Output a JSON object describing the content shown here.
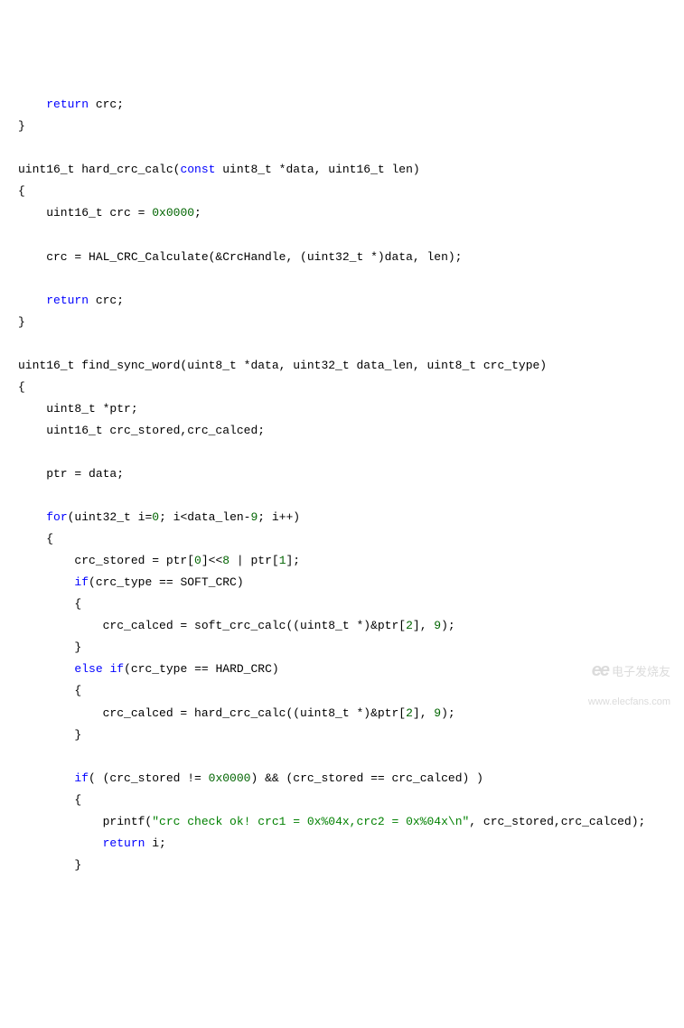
{
  "code": {
    "lines": [
      {
        "indent": 1,
        "tokens": [
          {
            "t": "return",
            "c": "kw"
          },
          {
            "t": " crc;",
            "c": ""
          }
        ]
      },
      {
        "indent": 0,
        "tokens": [
          {
            "t": "}",
            "c": ""
          }
        ]
      },
      {
        "indent": 0,
        "tokens": []
      },
      {
        "indent": 0,
        "tokens": [
          {
            "t": "uint16_t hard_crc_calc(",
            "c": ""
          },
          {
            "t": "const",
            "c": "kw"
          },
          {
            "t": " uint8_t *data, uint16_t len)",
            "c": ""
          }
        ]
      },
      {
        "indent": 0,
        "tokens": [
          {
            "t": "{",
            "c": ""
          }
        ]
      },
      {
        "indent": 1,
        "tokens": [
          {
            "t": "uint16_t crc = ",
            "c": ""
          },
          {
            "t": "0x0000",
            "c": "num"
          },
          {
            "t": ";",
            "c": ""
          }
        ]
      },
      {
        "indent": 0,
        "tokens": []
      },
      {
        "indent": 1,
        "tokens": [
          {
            "t": "crc = HAL_CRC_Calculate(&CrcHandle, (uint32_t *)data, len);",
            "c": ""
          }
        ]
      },
      {
        "indent": 0,
        "tokens": []
      },
      {
        "indent": 1,
        "tokens": [
          {
            "t": "return",
            "c": "kw"
          },
          {
            "t": " crc;",
            "c": ""
          }
        ]
      },
      {
        "indent": 0,
        "tokens": [
          {
            "t": "}",
            "c": ""
          }
        ]
      },
      {
        "indent": 0,
        "tokens": []
      },
      {
        "indent": 0,
        "tokens": [
          {
            "t": "uint16_t find_sync_word(uint8_t *data, uint32_t data_len, uint8_t crc_type)",
            "c": ""
          }
        ]
      },
      {
        "indent": 0,
        "tokens": [
          {
            "t": "{",
            "c": ""
          }
        ]
      },
      {
        "indent": 1,
        "tokens": [
          {
            "t": "uint8_t *ptr;",
            "c": ""
          }
        ]
      },
      {
        "indent": 1,
        "tokens": [
          {
            "t": "uint16_t crc_stored,crc_calced;",
            "c": ""
          }
        ]
      },
      {
        "indent": 0,
        "tokens": []
      },
      {
        "indent": 1,
        "tokens": [
          {
            "t": "ptr = data;",
            "c": ""
          }
        ]
      },
      {
        "indent": 0,
        "tokens": []
      },
      {
        "indent": 1,
        "tokens": [
          {
            "t": "for",
            "c": "kw"
          },
          {
            "t": "(uint32_t i=",
            "c": ""
          },
          {
            "t": "0",
            "c": "num"
          },
          {
            "t": "; i<data_len-",
            "c": ""
          },
          {
            "t": "9",
            "c": "num"
          },
          {
            "t": "; i++)",
            "c": ""
          }
        ]
      },
      {
        "indent": 1,
        "tokens": [
          {
            "t": "{",
            "c": ""
          }
        ]
      },
      {
        "indent": 2,
        "tokens": [
          {
            "t": "crc_stored = ptr[",
            "c": ""
          },
          {
            "t": "0",
            "c": "num"
          },
          {
            "t": "]<<",
            "c": ""
          },
          {
            "t": "8",
            "c": "num"
          },
          {
            "t": " | ptr[",
            "c": ""
          },
          {
            "t": "1",
            "c": "num"
          },
          {
            "t": "];",
            "c": ""
          }
        ]
      },
      {
        "indent": 2,
        "tokens": [
          {
            "t": "if",
            "c": "kw"
          },
          {
            "t": "(crc_type == SOFT_CRC)",
            "c": ""
          }
        ]
      },
      {
        "indent": 2,
        "tokens": [
          {
            "t": "{",
            "c": ""
          }
        ]
      },
      {
        "indent": 3,
        "tokens": [
          {
            "t": "crc_calced = soft_crc_calc((uint8_t *)&ptr[",
            "c": ""
          },
          {
            "t": "2",
            "c": "num"
          },
          {
            "t": "], ",
            "c": ""
          },
          {
            "t": "9",
            "c": "num"
          },
          {
            "t": ");",
            "c": ""
          }
        ]
      },
      {
        "indent": 2,
        "tokens": [
          {
            "t": "}",
            "c": ""
          }
        ]
      },
      {
        "indent": 2,
        "tokens": [
          {
            "t": "else",
            "c": "kw"
          },
          {
            "t": " ",
            "c": ""
          },
          {
            "t": "if",
            "c": "kw"
          },
          {
            "t": "(crc_type == HARD_CRC)",
            "c": ""
          }
        ]
      },
      {
        "indent": 2,
        "tokens": [
          {
            "t": "{",
            "c": ""
          }
        ]
      },
      {
        "indent": 3,
        "tokens": [
          {
            "t": "crc_calced = hard_crc_calc((uint8_t *)&ptr[",
            "c": ""
          },
          {
            "t": "2",
            "c": "num"
          },
          {
            "t": "], ",
            "c": ""
          },
          {
            "t": "9",
            "c": "num"
          },
          {
            "t": ");",
            "c": ""
          }
        ]
      },
      {
        "indent": 2,
        "tokens": [
          {
            "t": "}",
            "c": ""
          }
        ]
      },
      {
        "indent": 0,
        "tokens": []
      },
      {
        "indent": 2,
        "tokens": [
          {
            "t": "if",
            "c": "kw"
          },
          {
            "t": "( (crc_stored != ",
            "c": ""
          },
          {
            "t": "0x0000",
            "c": "num"
          },
          {
            "t": ") && (crc_stored == crc_calced) )",
            "c": ""
          }
        ]
      },
      {
        "indent": 2,
        "tokens": [
          {
            "t": "{",
            "c": ""
          }
        ]
      },
      {
        "indent": 3,
        "tokens": [
          {
            "t": "printf(",
            "c": ""
          },
          {
            "t": "\"crc check ok! crc1 = 0x%04x,crc2 = 0x%04x\\n\"",
            "c": "str"
          },
          {
            "t": ", crc_stored,crc_calced);",
            "c": ""
          }
        ]
      },
      {
        "indent": 3,
        "tokens": [
          {
            "t": "return",
            "c": "kw"
          },
          {
            "t": " i;",
            "c": ""
          }
        ]
      },
      {
        "indent": 2,
        "tokens": [
          {
            "t": "}",
            "c": ""
          }
        ]
      }
    ]
  },
  "watermark": {
    "logo": "ee",
    "cn": "电子发烧友",
    "url": "www.elecfans.com"
  }
}
